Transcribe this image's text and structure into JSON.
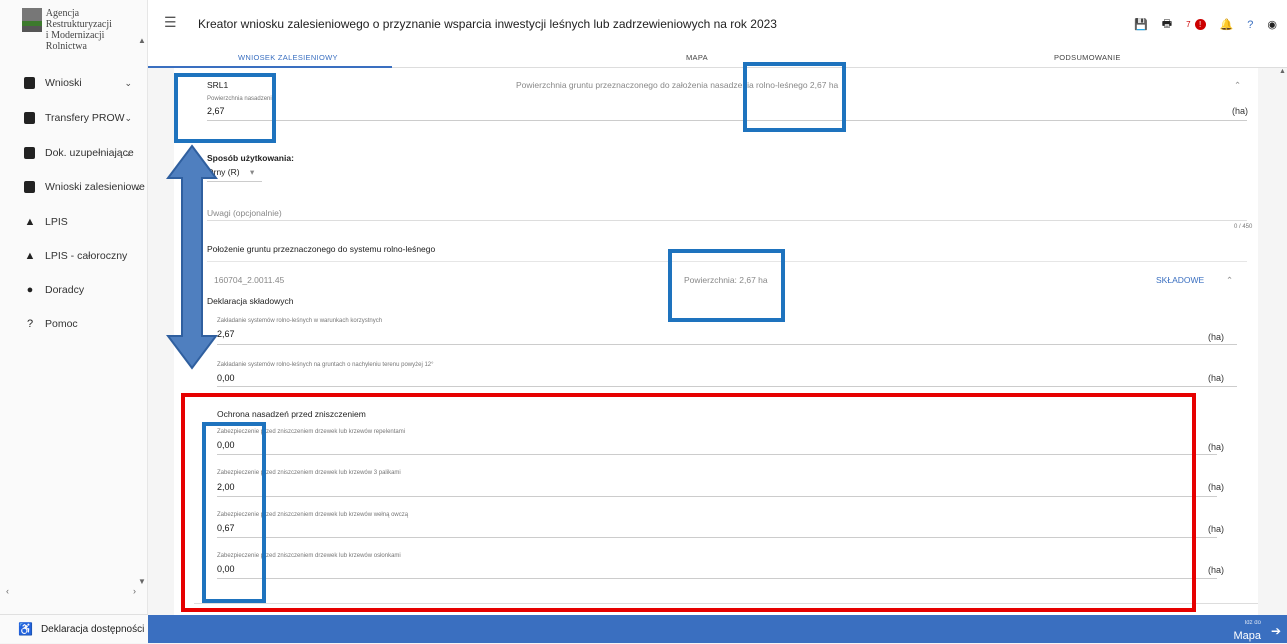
{
  "sidebar": {
    "logo_line1": "Agencja Restrukturyzacji",
    "logo_line2": "i Modernizacji Rolnictwa",
    "items": [
      {
        "label": "Wnioski",
        "icon": "document-icon",
        "chevron": "⌄"
      },
      {
        "label": "Transfery PROW",
        "icon": "document-icon",
        "chevron": "⌄"
      },
      {
        "label": "Dok. uzupełniające",
        "icon": "document-icon",
        "chevron": "⌄"
      },
      {
        "label": "Wnioski zalesieniowe",
        "icon": "document-icon",
        "chevron": "⌄"
      },
      {
        "label": "LPIS",
        "icon": "terrain-icon",
        "chevron": ""
      },
      {
        "label": "LPIS - całoroczny",
        "icon": "terrain-icon",
        "chevron": ""
      },
      {
        "label": "Doradcy",
        "icon": "person-icon",
        "chevron": ""
      },
      {
        "label": "Pomoc",
        "icon": "help-icon",
        "chevron": ""
      }
    ],
    "accessibility": "Deklaracja dostępności"
  },
  "header": {
    "title": "Kreator wniosku zalesieniowego o przyznanie wsparcia inwestycji leśnych lub zadrzewieniowych na rok 2023",
    "notification_count": "7",
    "badge": "!"
  },
  "tabs": [
    "WNIOSEK ZALESIENIOWY",
    "MAPA",
    "PODSUMOWANIE"
  ],
  "form": {
    "plot_id": "SRL1",
    "planting_area_label": "Powierzchnia nasadzenia",
    "planting_area_value": "2,67",
    "unit": "(ha)",
    "summary": "Powierzchnia gruntu przeznaczonego do założenia nasadzenia rolno-leśnego 2,67 ha",
    "usage_label": "Sposób użytkowania:",
    "usage_value": "Orny (R)",
    "notes_placeholder": "Uwagi (opcjonalnie)",
    "notes_counter": "0 / 450",
    "location_title": "Położenie gruntu przeznaczonego do systemu rolno-leśnego",
    "parcel_id": "160704_2.0011.45",
    "parcel_area": "Powierzchnia: 2,67 ha",
    "components_link": "SKŁADOWE",
    "declaration_title": "Deklaracja składowych",
    "components": [
      {
        "label": "Zakładanie systemów rolno-leśnych w warunkach korzystnych",
        "value": "2,67"
      },
      {
        "label": "Zakładanie systemów rolno-leśnych na gruntach o nachyleniu terenu powyżej 12°",
        "value": "0,00"
      }
    ],
    "protection_title": "Ochrona nasadzeń przed zniszczeniem",
    "protections": [
      {
        "label": "Zabezpieczenie przed zniszczeniem drzewek lub krzewów repelentami",
        "value": "0,00"
      },
      {
        "label": "Zabezpieczenie przed zniszczeniem drzewek lub krzewów 3 palikami",
        "value": "2,00"
      },
      {
        "label": "Zabezpieczenie przed zniszczeniem drzewek lub krzewów wełną owczą",
        "value": "0,67"
      },
      {
        "label": "Zabezpieczenie przed zniszczeniem drzewek lub krzewów osłonkami",
        "value": "0,00"
      }
    ]
  },
  "footer": {
    "next_small": "Idź do",
    "next_label": "Mapa"
  },
  "colors": {
    "accent": "#3a6fc0",
    "highlight_blue": "#1e73be",
    "highlight_red": "#e60000"
  }
}
